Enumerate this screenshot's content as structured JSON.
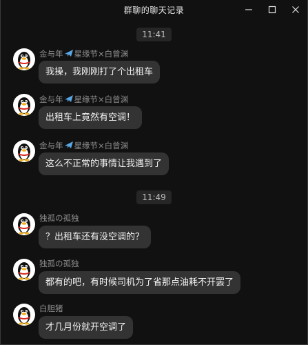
{
  "window": {
    "title": "群聊的聊天记录",
    "controls": [
      "minimize-icon",
      "maximize-icon",
      "close-icon"
    ]
  },
  "timestamps": [
    "11:41",
    "11:49"
  ],
  "messages": [
    {
      "sender_pre": "金与年",
      "sender_icon": "airplane-icon",
      "sender_post": "星缘节×白曾渊",
      "text": "我操，我刚刚打了个出租车"
    },
    {
      "sender_pre": "金与年",
      "sender_icon": "airplane-icon",
      "sender_post": "星缘节×白曾渊",
      "text": "出租车上竟然有空调！"
    },
    {
      "sender_pre": "金与年",
      "sender_icon": "airplane-icon",
      "sender_post": "星缘节×白曾渊",
      "text": "这么不正常的事情让我遇到了"
    },
    {
      "sender_pre": "独孤の孤独",
      "text": "？出租车还有没空调的？"
    },
    {
      "sender_pre": "独孤の孤独",
      "text": "都有的吧，有时候司机为了省那点油耗不开罢了"
    },
    {
      "sender_pre": "白胆猪",
      "text": "才几月份就开空调了"
    }
  ],
  "colors": {
    "background": "#111111",
    "bubble": "#333333",
    "sender_text": "#8f8f8f",
    "plane_blue": "#5aa7e6"
  }
}
